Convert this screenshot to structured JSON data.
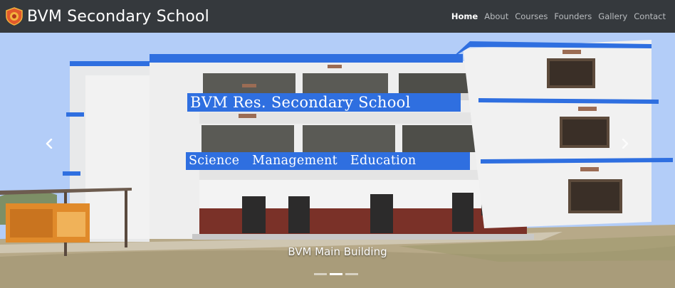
{
  "brand": {
    "name": "BVM Secondary School",
    "logo_icon": "school-crest-icon"
  },
  "nav": {
    "items": [
      {
        "label": "Home",
        "active": true
      },
      {
        "label": "About",
        "active": false
      },
      {
        "label": "Courses",
        "active": false
      },
      {
        "label": "Founders",
        "active": false
      },
      {
        "label": "Gallery",
        "active": false
      },
      {
        "label": "Contact",
        "active": false
      }
    ]
  },
  "carousel": {
    "banner_line_1": "BVM Res. Secondary School",
    "banner_line_2": "Science Management Education",
    "caption": "BVM Main Building",
    "slide_count": 3,
    "active_slide": 1,
    "prev_icon": "chevron-left-icon",
    "next_icon": "chevron-right-icon"
  },
  "colors": {
    "navbar_bg": "#35393d",
    "nav_text": "#b9bcbf",
    "nav_active": "#ffffff",
    "banner_blue": "#2f6fe0",
    "sky": "#b3cdf8"
  }
}
